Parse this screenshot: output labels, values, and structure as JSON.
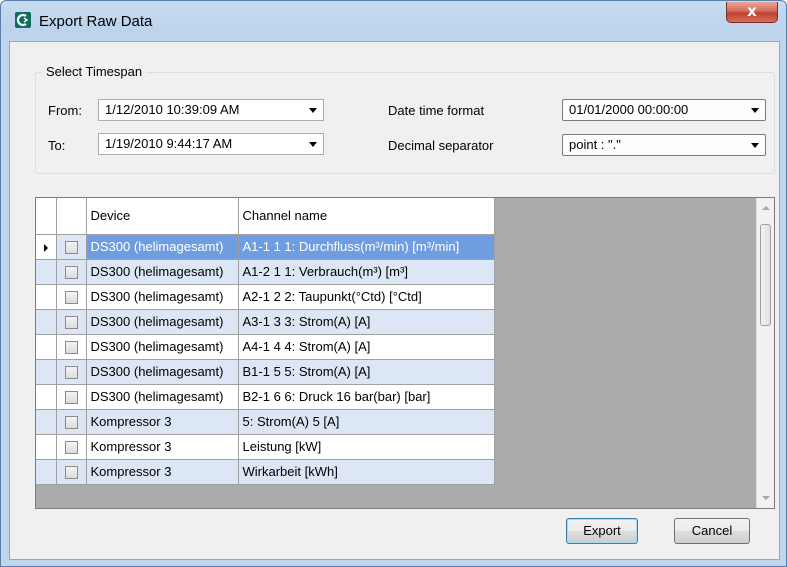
{
  "window": {
    "title": "Export Raw Data",
    "close_label": "x"
  },
  "timespan": {
    "group_label": "Select Timespan",
    "from_label": "From:",
    "from_value": "1/12/2010 10:39:09 AM",
    "to_label": "To:",
    "to_value": "1/19/2010 9:44:17 AM",
    "date_format_label": "Date time format",
    "date_format_value": "01/01/2000 00:00:00",
    "decimal_label": "Decimal separator",
    "decimal_value": "point : \".\""
  },
  "grid": {
    "headers": {
      "device": "Device",
      "channel": "Channel name"
    },
    "rows": [
      {
        "device": "DS300 (helimagesamt)",
        "channel": "A1-1 1 1: Durchfluss(m³/min) [m³/min]"
      },
      {
        "device": "DS300 (helimagesamt)",
        "channel": "A1-2 1 1: Verbrauch(m³) [m³]"
      },
      {
        "device": "DS300 (helimagesamt)",
        "channel": "A2-1 2 2: Taupunkt(°Ctd) [°Ctd]"
      },
      {
        "device": "DS300 (helimagesamt)",
        "channel": "A3-1 3 3: Strom(A) [A]"
      },
      {
        "device": "DS300 (helimagesamt)",
        "channel": "A4-1 4 4: Strom(A) [A]"
      },
      {
        "device": "DS300 (helimagesamt)",
        "channel": "B1-1 5 5: Strom(A) [A]"
      },
      {
        "device": "DS300 (helimagesamt)",
        "channel": "B2-1 6 6: Druck 16 bar(bar) [bar]"
      },
      {
        "device": "Kompressor 3",
        "channel": "5: Strom(A) 5 [A]"
      },
      {
        "device": "Kompressor 3",
        "channel": "Leistung  [kW]"
      },
      {
        "device": "Kompressor 3",
        "channel": "Wirkarbeit  [kWh]"
      }
    ]
  },
  "buttons": {
    "export": "Export",
    "cancel": "Cancel"
  },
  "colors": {
    "selection": "#6f9ee0",
    "alt_row": "#dce6f4",
    "titlebar": "#c0d6ee"
  }
}
